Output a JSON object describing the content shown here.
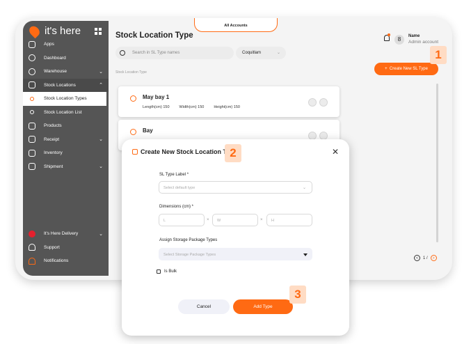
{
  "app": {
    "brand": "it's here",
    "account_tab": "All Accounts"
  },
  "sidebar": {
    "items": [
      {
        "label": "Apps",
        "icon": "apps-grid-icon"
      },
      {
        "label": "Dashboard",
        "icon": "gauge-icon"
      },
      {
        "label": "Warehouse",
        "icon": "warehouse-icon",
        "chevron": "⌄"
      },
      {
        "label": "Stock Locations",
        "icon": "location-grid-icon",
        "chevron": "⌃"
      },
      {
        "label": "Stock Location Types",
        "icon": "dot-icon"
      },
      {
        "label": "Stock Location List",
        "icon": "dot-icon"
      },
      {
        "label": "Products",
        "icon": "box-icon"
      },
      {
        "label": "Receipt",
        "icon": "receipt-icon",
        "chevron": "⌄"
      },
      {
        "label": "Inventory",
        "icon": "inventory-icon"
      },
      {
        "label": "Shipment",
        "icon": "truck-icon",
        "chevron": "⌄"
      }
    ],
    "bottom": [
      {
        "label": "It's Here Delivery",
        "icon": "delivery-icon",
        "chevron": "⌄"
      },
      {
        "label": "Support",
        "icon": "headset-icon"
      },
      {
        "label": "Notifications",
        "icon": "bell-icon"
      }
    ]
  },
  "header": {
    "title": "Stock Location Type",
    "user_name": "Name",
    "user_role": "Admin account",
    "avatar_glyph": "8"
  },
  "toolbar": {
    "search_placeholder": "Search in SL Type names",
    "city": "Coquitlam",
    "breadcrumb": "Stock Location Type",
    "create_button": "Create New SL Type"
  },
  "cards": [
    {
      "name": "May bay 1",
      "length_label": "Length(cm)",
      "length": "150",
      "width_label": "Width(cm)",
      "width": "150",
      "height_label": "Height(cm)",
      "height": "150"
    },
    {
      "name": "Bay"
    }
  ],
  "pager": {
    "text": "1 /"
  },
  "modal": {
    "title": "Create New Stock Location Type",
    "type_label": "SL Type Label *",
    "type_placeholder": "Select default type",
    "dimensions_label": "Dimensions (cm) *",
    "l_placeholder": "L",
    "w_placeholder": "W",
    "h_placeholder": "H",
    "times": "×",
    "storage_label": "Assign Storage Package Types",
    "storage_placeholder": "Select Storage Package Types",
    "bulk_label": "Is Bulk",
    "cancel": "Cancel",
    "add": "Add Type"
  },
  "steps": [
    "1",
    "2",
    "3"
  ],
  "colors": {
    "accent": "#ff6a13",
    "sidebar": "#555555"
  }
}
